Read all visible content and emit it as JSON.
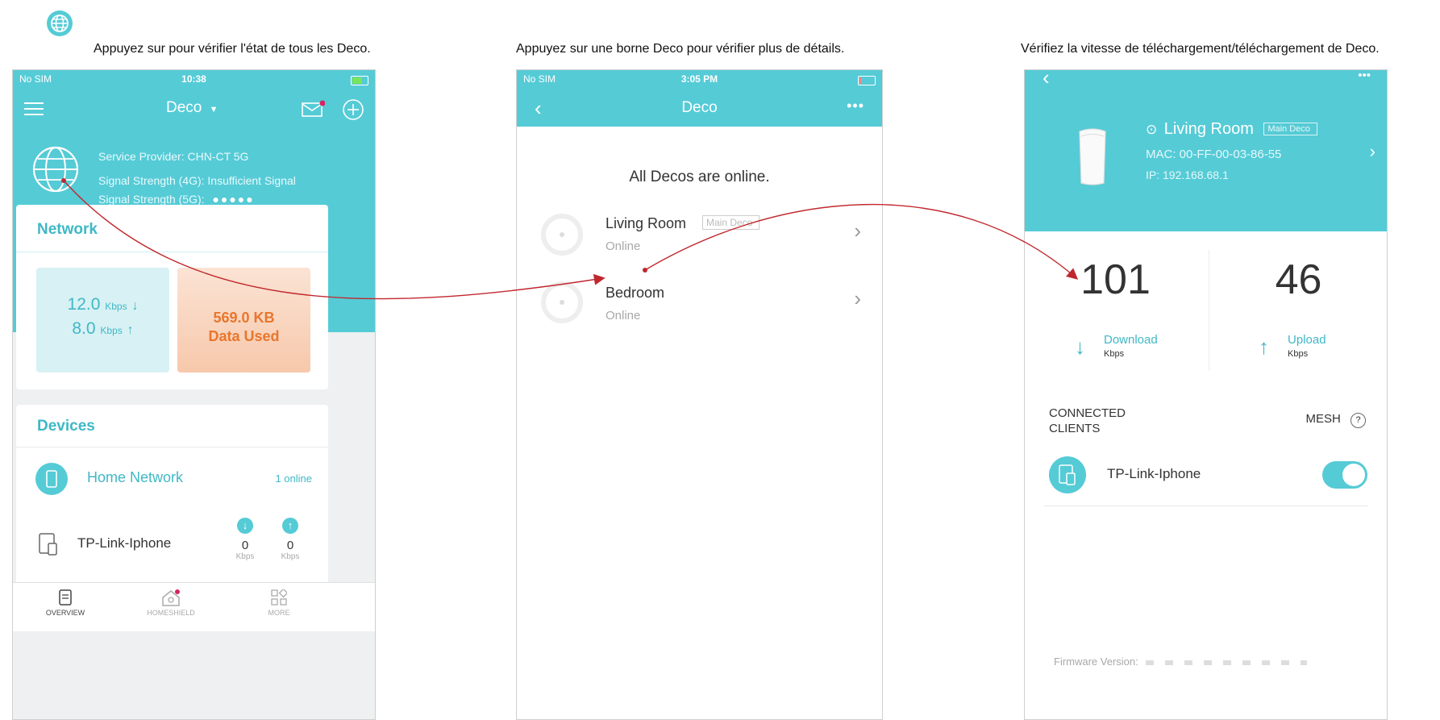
{
  "captions": {
    "c1": "Appuyez sur pour vérifier l'état de tous les Deco.",
    "c2": "Appuyez sur une borne Deco pour vérifier plus de détails.",
    "c3": "Vérifiez la vitesse de téléchargement/téléchargement de Deco."
  },
  "colors": {
    "teal": "#55cbd6",
    "orange": "#e8762d",
    "arrow": "#c0272d"
  },
  "icons": {
    "top_globe": "globe-icon"
  },
  "phone1": {
    "status": {
      "carrier": "No SIM",
      "time": "10:38"
    },
    "header": {
      "title": "Deco"
    },
    "isp": {
      "provider": "Service Provider: CHN-CT 5G",
      "signal4g": "Signal Strength (4G): Insufficient Signal",
      "signal5g": "Signal Strength (5G):",
      "signal5g_dots": "●●●●●"
    },
    "network": {
      "title": "Network",
      "down_value": "12.0",
      "up_value": "8.0",
      "unit": "Kbps",
      "data_used_value": "569.0 KB",
      "data_used_label": "Data Used"
    },
    "devices": {
      "title": "Devices",
      "group_name": "Home Network",
      "group_status": "1 online",
      "device_name": "TP-Link-Iphone",
      "down": "0",
      "up": "0",
      "unit": "Kbps"
    },
    "tabs": [
      "OVERVIEW",
      "HOMESHIELD",
      "MORE"
    ]
  },
  "phone2": {
    "status": {
      "carrier": "No SIM",
      "time": "3:05 PM"
    },
    "header": {
      "title": "Deco"
    },
    "heading": "All Decos are online.",
    "decos": [
      {
        "name": "Living Room",
        "badge": "Main Deco",
        "status": "Online"
      },
      {
        "name": "Bedroom",
        "badge": "",
        "status": "Online"
      }
    ]
  },
  "phone3": {
    "location": "Living Room",
    "badge": "Main Deco",
    "mac": "MAC: 00-FF-00-03-86-55",
    "ip": "IP: 192.168.68.1",
    "download": {
      "value": "101",
      "label": "Download",
      "unit": "Kbps"
    },
    "upload": {
      "value": "46",
      "label": "Upload",
      "unit": "Kbps"
    },
    "clients_label_1": "CONNECTED",
    "clients_label_2": "CLIENTS",
    "mesh_label": "MESH",
    "client_name": "TP-Link-Iphone",
    "client_toggle_on": true,
    "firmware": "Firmware Version:"
  }
}
